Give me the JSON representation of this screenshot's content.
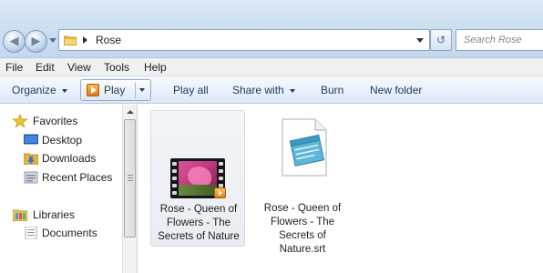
{
  "address_bar": {
    "breadcrumb": "Rose",
    "search_placeholder": "Search Rose"
  },
  "menu": [
    "File",
    "Edit",
    "View",
    "Tools",
    "Help"
  ],
  "commands": {
    "organize": "Organize",
    "play": "Play",
    "play_all": "Play all",
    "share_with": "Share with",
    "burn": "Burn",
    "new_folder": "New folder"
  },
  "nav_pane": {
    "favorites": "Favorites",
    "desktop": "Desktop",
    "downloads": "Downloads",
    "recent_places": "Recent Places",
    "libraries": "Libraries",
    "documents": "Documents"
  },
  "files": [
    {
      "name_lines": [
        "Rose - Queen of",
        "Flowers - The",
        "Secrets of Nature"
      ],
      "icon": "video-icon",
      "selected": true
    },
    {
      "name_lines": [
        "Rose - Queen of",
        "Flowers - The",
        "Secrets of",
        "Nature.srt"
      ],
      "icon": "notepad-icon",
      "selected": false
    }
  ],
  "colors": {
    "titlebar": "#cddff1",
    "command_text": "#1e395b",
    "selection": "#e9ecf1"
  }
}
